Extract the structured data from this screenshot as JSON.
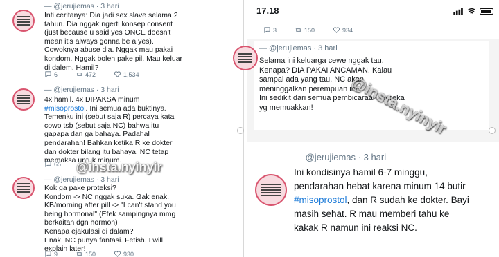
{
  "left": {
    "tweets": [
      {
        "handle": "— @jerujiemas · 3 hari",
        "lines": [
          "Inti ceritanya: Dia jadi sex slave selama 2",
          "tahun. Dia nggak ngerti konsep consent",
          "(just because u said yes ONCE doesn't",
          "mean it's always gonna be a yes).",
          "Cowoknya abuse dia. Nggak mau pakai",
          "kondom. Nggak boleh pake pil. Mau keluar",
          "di dalem. Hamil?"
        ],
        "replies": "6",
        "retweets": "472",
        "likes": "1,534"
      },
      {
        "handle": "— @jerujiemas · 3 hari",
        "line1": "4x hamil. 4x DIPAKSA minum",
        "hashtag": "#misoprostol",
        "line2_rest": ". Ini semua ada buktinya.",
        "lines": [
          "Temenku ini (sebut saja R) percaya kata",
          "cowo tsb (sebut saja NC) bahwa itu",
          "gapapa dan ga bahaya. Padahal",
          "pendarahan! Bahkan ketika R ke dokter",
          "dan dokter bilang itu bahaya, NC tetap",
          "memaksa untuk minum."
        ],
        "replies": "65",
        "retweets": "",
        "likes": ""
      },
      {
        "handle": "— @jerujiemas · 3 hari",
        "lines": [
          "Kok ga pake proteksi?",
          "Kondom -> NC nggak suka. Gak enak.",
          "KB/morning after pill -> \"I can't stand you",
          "being hormonal\" (Efek sampingnya mmg",
          "berkaitan dgn hormon)",
          "Kenapa ejakulasi di dalam?",
          "Enak. NC punya fantasi. Fetish. I will",
          "explain later!"
        ],
        "replies": "9",
        "retweets": "150",
        "likes": "930"
      }
    ],
    "watermark": "@insta.nyinyir"
  },
  "right": {
    "time": "17.18",
    "top_counts": {
      "replies": "3",
      "retweets": "150",
      "likes": "934"
    },
    "tweet_mid": {
      "handle": "— @jerujiemas · 3 hari",
      "lines": [
        "Selama ini keluarga cewe nggak tau.",
        "Kenapa? DIA PAKAI ANCAMAN. Kalau",
        "sampai ada yang tau, NC akan",
        "meninggalkan perempuan ini.",
        "Ini sedikit dari semua pembicaraan mereka",
        "yg memuakkan!"
      ],
      "replies": "3",
      "retweets": "150",
      "likes": "934"
    },
    "tweet_bottom": {
      "handle": "— @jerujiemas · 3 hari",
      "line1": "Ini kondisinya hamil 6-7 minggu,",
      "line2": "pendarahan hebat karena minum 14 butir",
      "hashtag": "#misoprostol",
      "line3_rest": ", dan R sudah ke dokter. Bayi",
      "line4": "masih sehat. R mau memberi tahu ke",
      "line5": "kakak R namun ini reaksi NC."
    },
    "watermark": "@insta.nyinyir"
  },
  "colors": {
    "link": "#1d7bd8",
    "muted": "#657786",
    "avatar_border": "#d9556f"
  }
}
